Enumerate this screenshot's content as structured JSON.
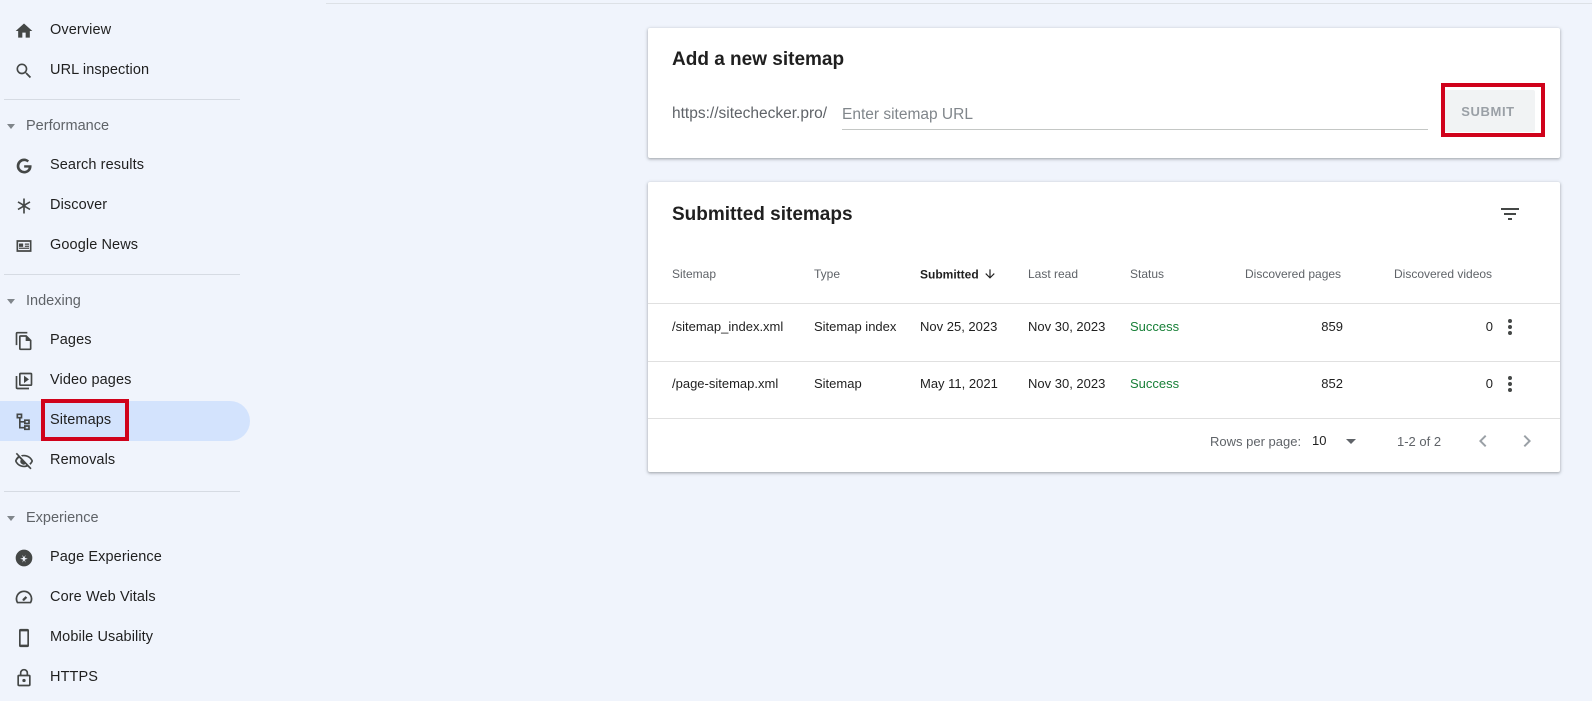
{
  "sidebar": {
    "items": [
      {
        "label": "Overview",
        "icon": "home-icon"
      },
      {
        "label": "URL inspection",
        "icon": "search-icon"
      },
      {
        "label": "Search results",
        "icon": "google-g-icon"
      },
      {
        "label": "Discover",
        "icon": "asterisk-icon"
      },
      {
        "label": "Google News",
        "icon": "news-icon"
      },
      {
        "label": "Pages",
        "icon": "pages-icon"
      },
      {
        "label": "Video pages",
        "icon": "video-pages-icon"
      },
      {
        "label": "Sitemaps",
        "icon": "sitemap-icon"
      },
      {
        "label": "Removals",
        "icon": "eye-off-icon"
      },
      {
        "label": "Page Experience",
        "icon": "page-experience-icon"
      },
      {
        "label": "Core Web Vitals",
        "icon": "gauge-icon"
      },
      {
        "label": "Mobile Usability",
        "icon": "phone-icon"
      },
      {
        "label": "HTTPS",
        "icon": "lock-icon"
      }
    ],
    "sections": {
      "performance": "Performance",
      "indexing": "Indexing",
      "experience": "Experience"
    },
    "active_item": "Sitemaps"
  },
  "add_sitemap": {
    "title": "Add a new sitemap",
    "url_prefix": "https://sitechecker.pro/",
    "input_value": "",
    "input_placeholder": "Enter sitemap URL",
    "submit_label": "SUBMIT"
  },
  "submitted": {
    "title": "Submitted sitemaps",
    "columns": [
      "Sitemap",
      "Type",
      "Submitted",
      "Last read",
      "Status",
      "Discovered pages",
      "Discovered videos"
    ],
    "sorted_column": "Submitted",
    "rows": [
      {
        "sitemap": "/sitemap_index.xml",
        "type": "Sitemap index",
        "submitted": "Nov 25, 2023",
        "last_read": "Nov 30, 2023",
        "status": "Success",
        "pages": "859",
        "videos": "0"
      },
      {
        "sitemap": "/page-sitemap.xml",
        "type": "Sitemap",
        "submitted": "May 11, 2021",
        "last_read": "Nov 30, 2023",
        "status": "Success",
        "pages": "852",
        "videos": "0"
      }
    ],
    "pagination": {
      "rows_per_page_label": "Rows per page:",
      "rows_per_page": "10",
      "range": "1-2 of 2"
    }
  },
  "colors": {
    "background": "#f0f4fc",
    "active_nav": "#d3e3fd",
    "success": "#188038",
    "highlight": "#d0021b"
  }
}
